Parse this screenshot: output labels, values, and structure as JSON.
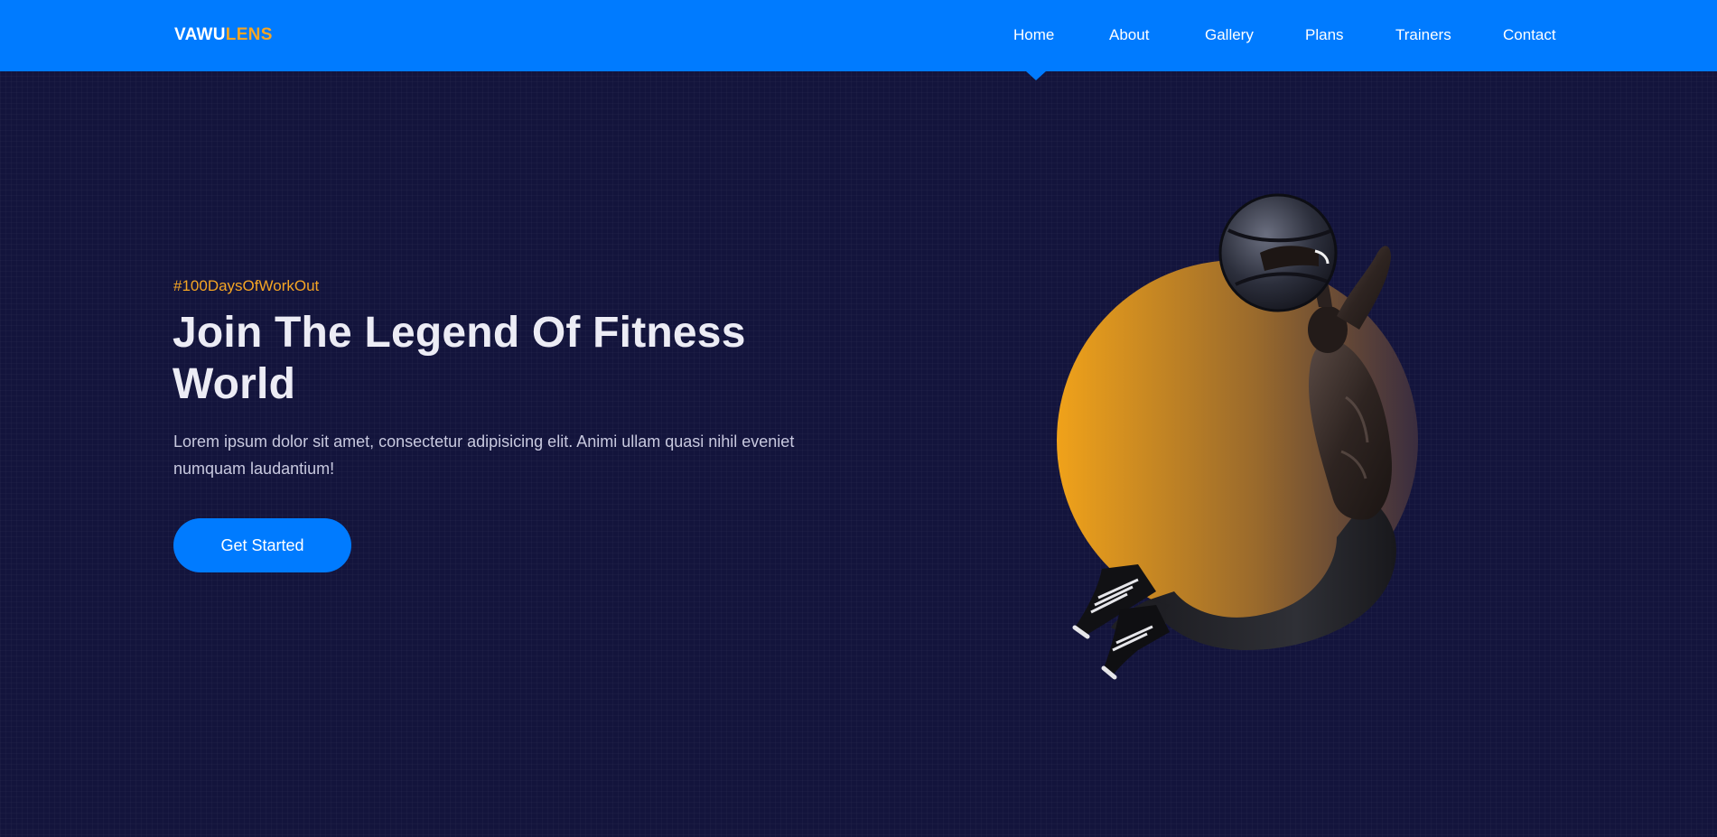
{
  "brand": {
    "part1": "VAWU",
    "part2": "LENS",
    "accent_color": "#f5a524",
    "primary_color": "#007bff"
  },
  "nav": {
    "items": [
      {
        "label": "Home",
        "active": true
      },
      {
        "label": "About"
      },
      {
        "label": "Gallery"
      },
      {
        "label": "Plans"
      },
      {
        "label": "Trainers"
      },
      {
        "label": "Contact"
      }
    ]
  },
  "hero": {
    "hashtag": "#100DaysOfWorkOut",
    "title": "Join The Legend Of Fitness World",
    "text": "Lorem ipsum dolor sit amet, consectetur adipisicing elit. Animi ullam quasi nihil eveniet numquam laudantium!",
    "cta_label": "Get Started",
    "image_label": "athlete-with-medicine-ball"
  },
  "colors": {
    "background": "#13143c",
    "circle_gradient_start": "#f0a21a",
    "circle_gradient_end": "#3a2d3f"
  }
}
